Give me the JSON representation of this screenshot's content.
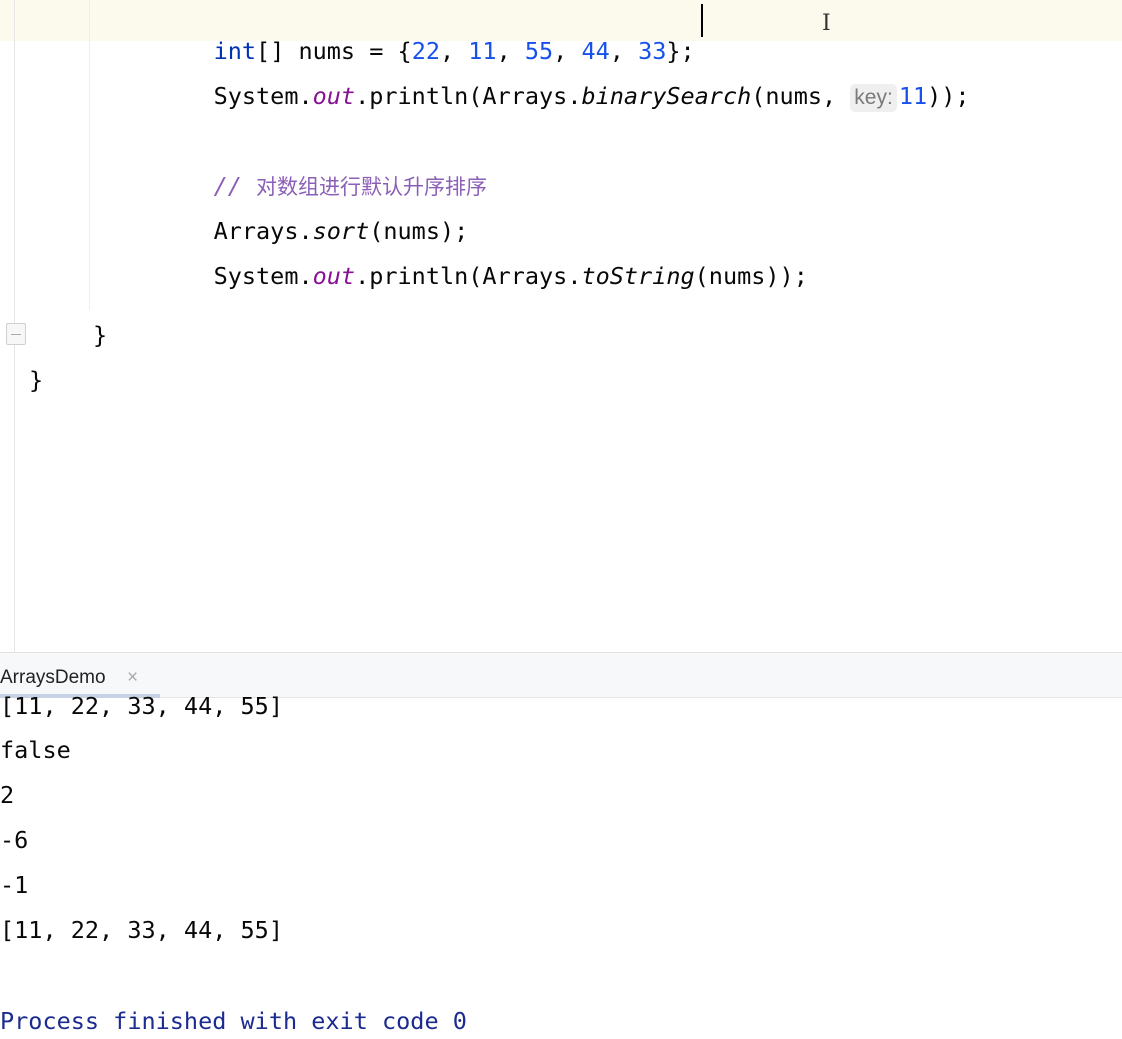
{
  "editor": {
    "line1": {
      "kw": "int",
      "decl": "[] nums = {",
      "n1": "22",
      "sep1": ", ",
      "n2": "11",
      "sep2": ", ",
      "n3": "55",
      "sep3": ", ",
      "n4": "44",
      "sep4": ", ",
      "n5": "33",
      "end": "};"
    },
    "line2": {
      "system": "System.",
      "out": "out",
      "println_open": ".println(Arrays.",
      "method": "binarySearch",
      "args": "(nums, ",
      "hint_label": "key:",
      "hint_value": "11",
      "close": "));"
    },
    "comment": {
      "slashes": "//",
      "text": "对数组进行默认升序排序"
    },
    "line4": {
      "prefix": "Arrays.",
      "method": "sort",
      "args": "(nums);"
    },
    "line5": {
      "system": "System.",
      "out": "out",
      "println_open": ".println(Arrays.",
      "method": "toString",
      "close": "(nums));"
    },
    "brace_method": "}",
    "brace_class": "}"
  },
  "run_panel": {
    "tab_label": "ArraysDemo",
    "close_glyph": "×",
    "output": [
      "[11, 22, 33, 44, 55]",
      "false",
      "2",
      "-6",
      "-1",
      "[11, 22, 33, 44, 55]"
    ],
    "exit_message": "Process finished with exit code 0"
  },
  "colors": {
    "keyword": "#0033b3",
    "number": "#1750eb",
    "static_field": "#871094",
    "comment": "#8c5fb7",
    "exit_text": "#1c2b8f"
  }
}
